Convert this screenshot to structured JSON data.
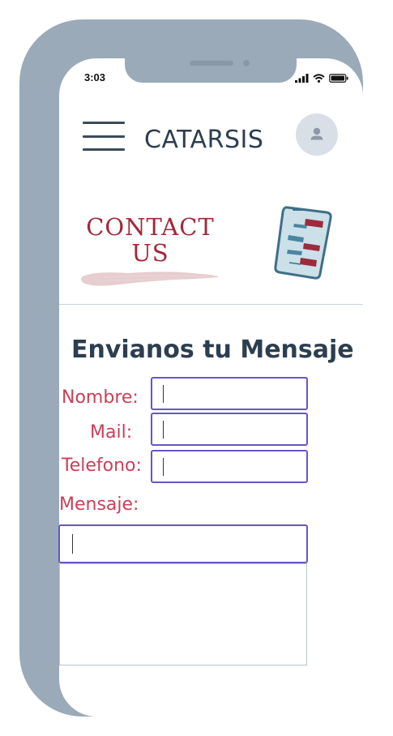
{
  "status_bar": {
    "time": "3:03",
    "icons": [
      "signal-icon",
      "wifi-icon",
      "battery-icon"
    ]
  },
  "header": {
    "brand": "CATARSIS",
    "menu_icon": "hamburger-icon",
    "avatar_icon": "user-icon"
  },
  "banner": {
    "title_line1": "CONTACT",
    "title_line2": "US"
  },
  "form": {
    "title": "Envianos tu Mensaje",
    "labels": {
      "name": "Nombre:",
      "mail": "Mail:",
      "phone": "Telefono:",
      "message": "Mensaje:"
    },
    "values": {
      "name": "",
      "mail": "",
      "phone": "",
      "message": ""
    }
  },
  "colors": {
    "frame": "#9aaab8",
    "accent": "#cc3f58",
    "heading": "#2c3e50",
    "field_border": "#6655cc"
  }
}
